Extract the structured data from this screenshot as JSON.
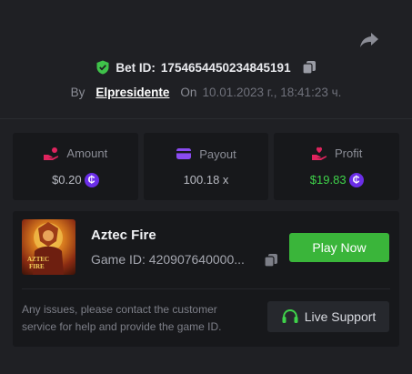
{
  "bet": {
    "id_label": "Bet ID:",
    "id_value": "1754654450234845191",
    "by_label": "By",
    "user": "Elpresidente",
    "on_label": "On",
    "date": "10.01.2023 г., 18:41:23 ч."
  },
  "stats": {
    "amount": {
      "label": "Amount",
      "value": "$0.20",
      "icon": "hand-coins-icon",
      "color": "#e0245e"
    },
    "payout": {
      "label": "Payout",
      "value": "100.18 x",
      "icon": "wallet-card-icon",
      "color": "#8a4bf0"
    },
    "profit": {
      "label": "Profit",
      "value": "$19.83",
      "icon": "hand-heart-icon",
      "color": "#e0245e",
      "value_color": "#3fd24a"
    }
  },
  "coin_symbol": "₵",
  "game": {
    "title": "Aztec Fire",
    "id_text": "Game ID: 420907640000...",
    "thumb_logo_line1": "AZTEC",
    "thumb_logo_line2": "FIRE",
    "play_label": "Play Now"
  },
  "help": {
    "text": "Any issues, please contact the customer service for help and provide the game ID.",
    "support_label": "Live Support"
  },
  "colors": {
    "background": "#1f2024",
    "card": "#17181b",
    "play_button": "#3ab53a",
    "shield": "#3fc24a",
    "coin": "#6b2ee8"
  }
}
